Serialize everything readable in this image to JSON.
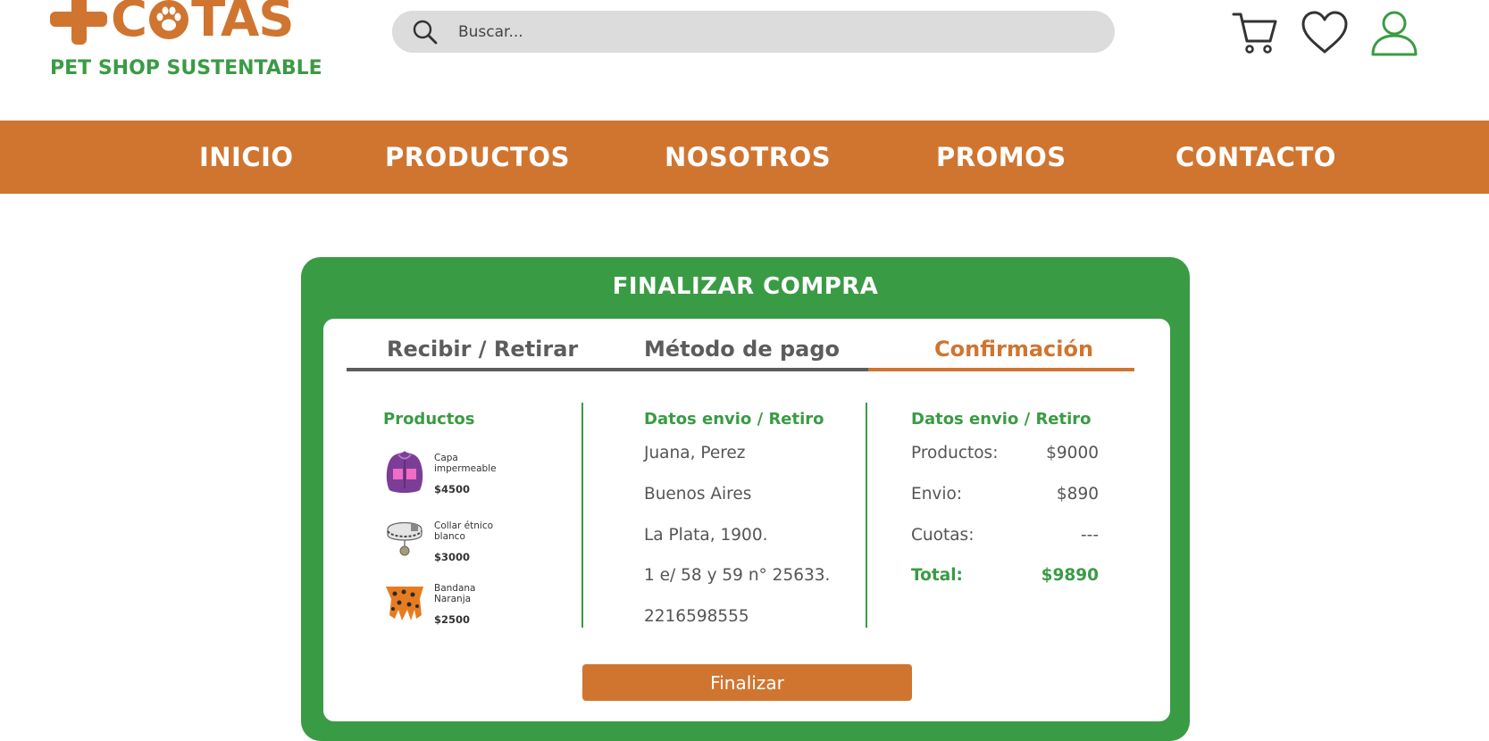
{
  "brand": {
    "name": "+COTAS",
    "name_left": "+",
    "name_first": "C",
    "name_rest": "TAS",
    "tagline": "PET SHOP SUSTENTABLE"
  },
  "search": {
    "placeholder": "Buscar..."
  },
  "header_icons": [
    "cart-icon",
    "heart-icon",
    "user-icon"
  ],
  "nav": {
    "items": [
      "INICIO",
      "PRODUCTOS",
      "NOSOTROS",
      "PROMOS",
      "CONTACTO"
    ]
  },
  "checkout": {
    "title": "FINALIZAR COMPRA",
    "steps": [
      {
        "label": "Recibir / Retirar",
        "state": "done"
      },
      {
        "label": "Método de pago",
        "state": "done"
      },
      {
        "label": "Confirmación",
        "state": "active"
      }
    ],
    "products": {
      "heading": "Productos",
      "items": [
        {
          "name": "Capa impermeable",
          "price": "$4500",
          "thumb": "raincoat-thumbnail"
        },
        {
          "name": "Collar étnico blanco",
          "price": "$3000",
          "thumb": "collar-thumbnail"
        },
        {
          "name": "Bandana Naranja",
          "price": "$2500",
          "thumb": "bandana-thumbnail"
        }
      ]
    },
    "shipping": {
      "heading": "Datos envio / Retiro",
      "lines": [
        "Juana, Perez",
        "Buenos Aires",
        "La Plata, 1900.",
        "1 e/ 58 y 59 n° 25633.",
        "2216598555"
      ]
    },
    "summary": {
      "heading": "Datos envio / Retiro",
      "rows": [
        {
          "label": "Productos:",
          "value": "$9000"
        },
        {
          "label": "Envio:",
          "value": "$890"
        },
        {
          "label": "Cuotas:",
          "value": "---"
        },
        {
          "label": "Total:",
          "value": "$9890"
        }
      ]
    },
    "finalize_label": "Finalizar"
  },
  "colors": {
    "orange": "#d07530",
    "green": "#3a9b45",
    "grey": "#dcdcdc",
    "step_done": "#5c5c5c"
  }
}
